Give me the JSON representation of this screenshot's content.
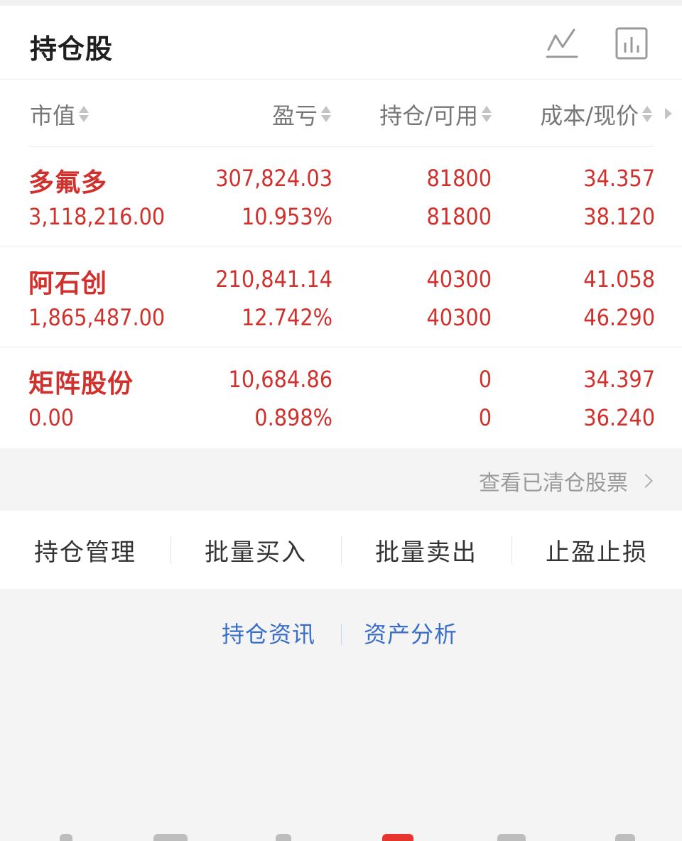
{
  "header": {
    "title": "持仓股",
    "icons": [
      "line-chart-icon",
      "bar-chart-icon"
    ]
  },
  "columns": [
    {
      "label": "市值"
    },
    {
      "label": "盈亏"
    },
    {
      "label": "持仓/可用"
    },
    {
      "label": "成本/现价"
    }
  ],
  "holdings": [
    {
      "name": "多氟多",
      "market_value": "3,118,216.00",
      "profit": "307,824.03",
      "profit_pct": "10.953%",
      "position": "81800",
      "available": "81800",
      "cost": "34.357",
      "price": "38.120"
    },
    {
      "name": "阿石创",
      "market_value": "1,865,487.00",
      "profit": "210,841.14",
      "profit_pct": "12.742%",
      "position": "40300",
      "available": "40300",
      "cost": "41.058",
      "price": "46.290"
    },
    {
      "name": "矩阵股份",
      "market_value": "0.00",
      "profit": "10,684.86",
      "profit_pct": "0.898%",
      "position": "0",
      "available": "0",
      "cost": "34.397",
      "price": "36.240"
    }
  ],
  "cleared_link": "查看已清仓股票",
  "actions": [
    "持仓管理",
    "批量买入",
    "批量卖出",
    "止盈止损"
  ],
  "links": [
    "持仓资讯",
    "资产分析"
  ],
  "colors": {
    "profit_red": "#d0312d",
    "link_blue": "#3a6fc8"
  }
}
